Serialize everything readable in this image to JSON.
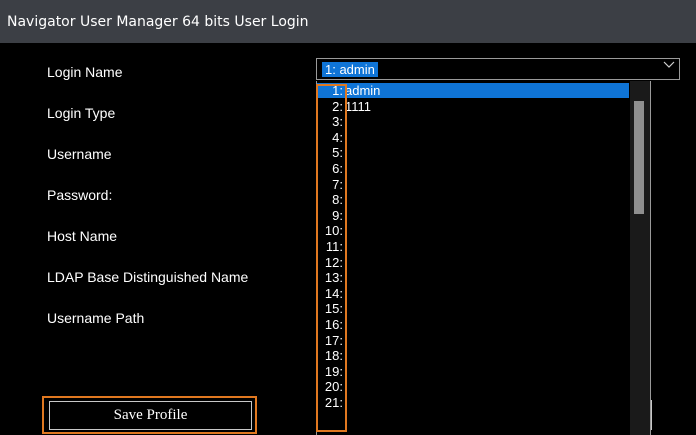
{
  "window": {
    "title": "Navigator User Manager 64 bits User Login"
  },
  "form": {
    "labels": {
      "login_name": "Login Name",
      "login_type": "Login Type",
      "username": "Username",
      "password": "Password:",
      "host_name": "Host Name",
      "ldap_base_dn": "LDAP Base Distinguished Name",
      "username_path": "Username Path"
    },
    "login_name_combo": {
      "selected": "1: admin"
    },
    "save_profile_label": "Save Profile"
  },
  "dropdown": {
    "options": [
      {
        "num": "1:",
        "name": "admin"
      },
      {
        "num": "2:",
        "name": "1111"
      },
      {
        "num": "3:",
        "name": ""
      },
      {
        "num": "4:",
        "name": ""
      },
      {
        "num": "5:",
        "name": ""
      },
      {
        "num": "6:",
        "name": ""
      },
      {
        "num": "7:",
        "name": ""
      },
      {
        "num": "8:",
        "name": ""
      },
      {
        "num": "9:",
        "name": ""
      },
      {
        "num": "10:",
        "name": ""
      },
      {
        "num": "11:",
        "name": ""
      },
      {
        "num": "12:",
        "name": ""
      },
      {
        "num": "13:",
        "name": ""
      },
      {
        "num": "14:",
        "name": ""
      },
      {
        "num": "15:",
        "name": ""
      },
      {
        "num": "16:",
        "name": ""
      },
      {
        "num": "17:",
        "name": ""
      },
      {
        "num": "18:",
        "name": ""
      },
      {
        "num": "19:",
        "name": ""
      },
      {
        "num": "20:",
        "name": ""
      },
      {
        "num": "21:",
        "name": ""
      }
    ],
    "highlighted_index": 0
  },
  "colors": {
    "accent": "#0f74d6",
    "annotation": "#e07820",
    "titlebar": "#3c3f45"
  },
  "icons": {
    "combo_arrow": "chevron-down-icon"
  }
}
